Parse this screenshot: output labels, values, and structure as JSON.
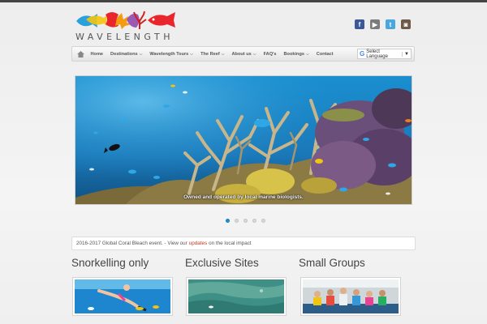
{
  "site": {
    "brand": "WAVELENGTH"
  },
  "social": [
    {
      "name": "facebook",
      "glyph": "f"
    },
    {
      "name": "youtube",
      "glyph": "▶"
    },
    {
      "name": "twitter",
      "glyph": "t"
    },
    {
      "name": "instagram",
      "glyph": "◙"
    }
  ],
  "nav": {
    "items": [
      {
        "label": "Home",
        "dropdown": false
      },
      {
        "label": "Destinations",
        "dropdown": true
      },
      {
        "label": "Wavelength Tours",
        "dropdown": true
      },
      {
        "label": "The Reef",
        "dropdown": true
      },
      {
        "label": "About us",
        "dropdown": true
      },
      {
        "label": "FAQ's",
        "dropdown": false
      },
      {
        "label": "Bookings",
        "dropdown": true
      },
      {
        "label": "Contact",
        "dropdown": false
      }
    ],
    "language": {
      "g": "G",
      "label": "Select Language",
      "arrow": "▼"
    }
  },
  "slider": {
    "caption": "Owned and operated by local marine biologists.",
    "slide_count": 5,
    "active_index": 0
  },
  "notice": {
    "before": "2016-2017 Global Coral Bleach event. - View our",
    "link": "updates",
    "after": "on the local impact"
  },
  "features": [
    {
      "title": "Snorkelling only"
    },
    {
      "title": "Exclusive Sites"
    },
    {
      "title": "Small Groups"
    }
  ],
  "colors": {
    "accent": "#1e8fd6",
    "link": "#c0392b",
    "ocean": "#1b6fb0"
  }
}
